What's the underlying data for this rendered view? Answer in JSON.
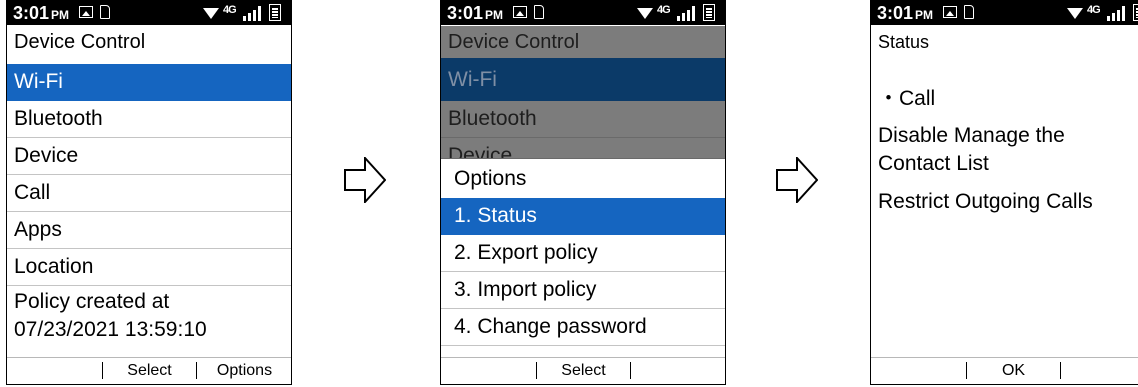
{
  "statusbar": {
    "time": "3:01",
    "ampm": "PM",
    "lte": "4G"
  },
  "screen1": {
    "title": "Device Control",
    "items": [
      "Wi-Fi",
      "Bluetooth",
      "Device",
      "Call",
      "Apps",
      "Location"
    ],
    "selected_index": 0,
    "policy_line1": "Policy created at",
    "policy_line2": "07/23/2021 13:59:10",
    "softkeys": {
      "left": "",
      "center": "Select",
      "right": "Options"
    }
  },
  "screen2": {
    "title": "Device Control",
    "background_items": [
      "Wi-Fi",
      "Bluetooth",
      "Device"
    ],
    "options_title": "Options",
    "options": [
      "1. Status",
      "2. Export policy",
      "3. Import policy",
      "4. Change password"
    ],
    "selected_index": 0,
    "softkeys": {
      "left": "",
      "center": "Select",
      "right": ""
    }
  },
  "screen3": {
    "title": "Status",
    "bullet_item": "・Call",
    "line1": "Disable Manage the",
    "line2": "Contact List",
    "line3": "Restrict Outgoing Calls",
    "softkeys": {
      "left": "",
      "center": "OK",
      "right": ""
    }
  },
  "colors": {
    "selection": "#1565c0",
    "statusbar": "#000000",
    "dim_overlay": "#7c7c7c"
  },
  "icons": [
    "image-icon",
    "sim-icon",
    "wifi-icon",
    "signal-icon",
    "battery-icon",
    "right-arrow-icon"
  ]
}
